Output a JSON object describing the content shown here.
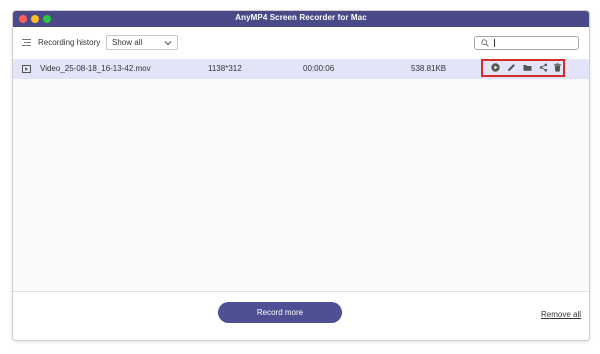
{
  "window": {
    "title": "AnyMP4 Screen Recorder for Mac",
    "titlebar_color": "#4a4a88",
    "traffic_lights": [
      "#ff5f57",
      "#febc2e",
      "#28c840"
    ]
  },
  "toolbar": {
    "history_icon": "list-icon",
    "history_label": "Recording history",
    "filter": {
      "selected": "Show all",
      "icon": "chevron-down-icon"
    },
    "search": {
      "placeholder": "",
      "value": "",
      "icon": "search-icon"
    }
  },
  "recordings": [
    {
      "file_icon": "video-file-icon",
      "name": "Video_25-08-18_16-13-42.mov",
      "resolution": "1138*312",
      "duration": "00:00:06",
      "size": "538.81KB",
      "actions": [
        "play-icon",
        "edit-icon",
        "folder-icon",
        "share-icon",
        "trash-icon"
      ],
      "selected": true
    }
  ],
  "footer": {
    "record_more_label": "Record more",
    "remove_all_label": "Remove all"
  },
  "colors": {
    "accent": "#4f4f94",
    "row_highlight": "#e4e4f8",
    "annotation_red": "#d42b2b"
  }
}
